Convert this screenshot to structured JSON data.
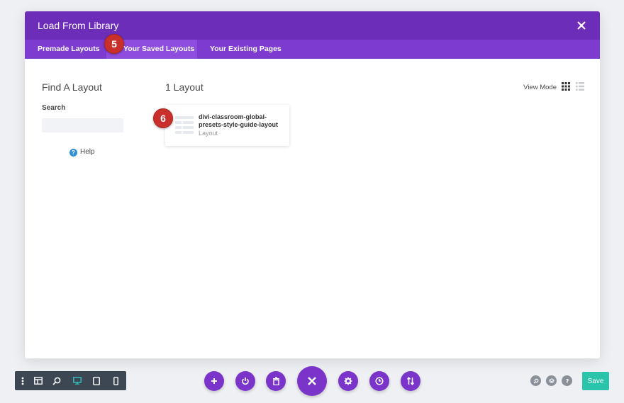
{
  "modal": {
    "title": "Load From Library",
    "close_icon": "close-icon",
    "tabs": [
      {
        "label": "Premade Layouts"
      },
      {
        "label": "Your Saved Layouts"
      },
      {
        "label": "Your Existing Pages"
      }
    ],
    "active_tab_index": 1
  },
  "badges": {
    "tab_step": "5",
    "card_step": "6"
  },
  "sidebar": {
    "title": "Find A Layout",
    "search_label": "Search",
    "search_value": "",
    "help_label": "Help"
  },
  "main": {
    "count_label": "1 Layout",
    "view_mode_label": "View Mode",
    "layouts": [
      {
        "name": "divi-classroom-global-presets-style-guide-layout",
        "type": "Layout"
      }
    ]
  },
  "bottom_bar": {
    "left_icons": [
      "more-vertical-icon",
      "wireframe-icon",
      "zoom-icon",
      "desktop-icon",
      "tablet-icon",
      "phone-icon"
    ],
    "center_icons": [
      "add-icon",
      "power-icon",
      "trash-icon",
      "close-icon",
      "gear-icon",
      "history-icon",
      "sort-icon"
    ],
    "right_icons": [
      "search-icon",
      "layers-icon",
      "help-icon"
    ],
    "save_label": "Save"
  },
  "colors": {
    "header": "#6c2eb9",
    "tabs_bar": "#7e3bd0",
    "active_tab": "#8f4de0",
    "badge": "#c9302c",
    "save": "#29c4a9",
    "circle_buttons": "#7b34c9"
  }
}
